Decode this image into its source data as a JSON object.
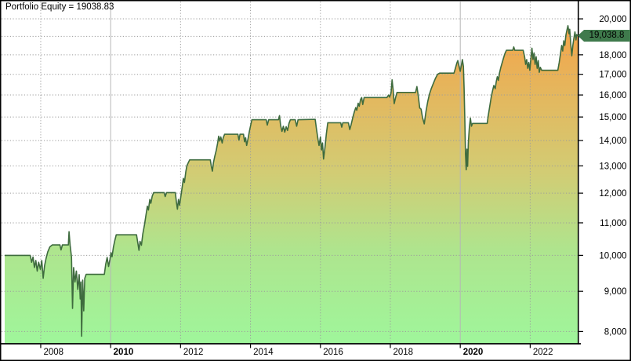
{
  "window": {
    "title": "Portfolio Equity = 19038.83"
  },
  "badge": {
    "label": "19,038.8"
  },
  "chart_data": {
    "type": "area",
    "title": "Portfolio Equity = 19038.83",
    "last_value": 19038.83,
    "legend": "none",
    "grid": true,
    "colors": {
      "line": "#3e6b3e",
      "fill_gradient": [
        "#f49f46",
        "#f0a94f",
        "#d2cc74",
        "#aee58e",
        "#9ff69b"
      ],
      "gradient_stops": [
        0,
        0.12,
        0.5,
        0.73,
        1
      ],
      "grid": "#9c9c9c",
      "decade_grid": "#b6b6b6",
      "axis": "#000000",
      "badge_bg": "#3f7a4c",
      "badge_text": "#000000",
      "background": "#ffffff"
    },
    "y_axis": {
      "side": "right",
      "scale": "log",
      "min": 7718,
      "max": 21040,
      "ticks": [
        {
          "value": 20000,
          "label": "20,000"
        },
        {
          "value": 19000,
          "label": ""
        },
        {
          "value": 18000,
          "label": "18,000"
        },
        {
          "value": 17000,
          "label": "17,000"
        },
        {
          "value": 16000,
          "label": "16,000"
        },
        {
          "value": 15000,
          "label": "15,000"
        },
        {
          "value": 14000,
          "label": "14,000"
        },
        {
          "value": 13000,
          "label": "13,000"
        },
        {
          "value": 12000,
          "label": "12,000"
        },
        {
          "value": 11000,
          "label": "11,000"
        },
        {
          "value": 10000,
          "label": "10,000"
        },
        {
          "value": 9000,
          "label": "9,000"
        },
        {
          "value": 8000,
          "label": "8,000"
        }
      ]
    },
    "x_axis": {
      "min": 2006.88,
      "max": 2023.37,
      "ticks": [
        {
          "year": 2008,
          "label": "2008",
          "bold": false
        },
        {
          "year": 2010,
          "label": "2010",
          "bold": true
        },
        {
          "year": 2012,
          "label": "2012",
          "bold": false
        },
        {
          "year": 2014,
          "label": "2014",
          "bold": false
        },
        {
          "year": 2016,
          "label": "2016",
          "bold": false
        },
        {
          "year": 2018,
          "label": "2018",
          "bold": false
        },
        {
          "year": 2020,
          "label": "2020",
          "bold": false
        },
        {
          "year": 2022,
          "label": "2022",
          "bold": false
        }
      ],
      "bold_ticks": [
        2010,
        2020
      ]
    },
    "series": [
      {
        "name": "Portfolio Equity",
        "points": [
          [
            2006.97,
            10000
          ],
          [
            2007.7,
            10000
          ],
          [
            2007.74,
            9800
          ],
          [
            2007.78,
            9950
          ],
          [
            2007.82,
            9650
          ],
          [
            2007.86,
            9850
          ],
          [
            2007.9,
            9550
          ],
          [
            2007.94,
            9800
          ],
          [
            2007.99,
            9600
          ],
          [
            2008.03,
            9850
          ],
          [
            2008.07,
            9350
          ],
          [
            2008.11,
            9700
          ],
          [
            2008.15,
            9900
          ],
          [
            2008.2,
            10100
          ],
          [
            2008.26,
            10250
          ],
          [
            2008.33,
            10310
          ],
          [
            2008.55,
            10310
          ],
          [
            2008.58,
            10160
          ],
          [
            2008.62,
            10310
          ],
          [
            2008.79,
            10310
          ],
          [
            2008.81,
            10720
          ],
          [
            2008.84,
            10310
          ],
          [
            2008.88,
            9950
          ],
          [
            2008.91,
            8560
          ],
          [
            2008.94,
            9650
          ],
          [
            2008.98,
            9250
          ],
          [
            2009.02,
            9550
          ],
          [
            2009.06,
            9050
          ],
          [
            2009.1,
            9450
          ],
          [
            2009.13,
            8800
          ],
          [
            2009.15,
            9250
          ],
          [
            2009.17,
            7890
          ],
          [
            2009.2,
            9300
          ],
          [
            2009.23,
            8500
          ],
          [
            2009.26,
            9350
          ],
          [
            2009.3,
            9460
          ],
          [
            2009.82,
            9460
          ],
          [
            2009.86,
            9750
          ],
          [
            2009.9,
            9940
          ],
          [
            2009.94,
            9680
          ],
          [
            2009.98,
            9880
          ],
          [
            2010.01,
            10080
          ],
          [
            2010.04,
            9960
          ],
          [
            2010.08,
            10250
          ],
          [
            2010.12,
            10450
          ],
          [
            2010.16,
            10620
          ],
          [
            2010.74,
            10620
          ],
          [
            2010.78,
            10350
          ],
          [
            2010.81,
            10150
          ],
          [
            2010.84,
            10420
          ],
          [
            2010.88,
            10300
          ],
          [
            2010.92,
            10650
          ],
          [
            2010.97,
            10950
          ],
          [
            2011.01,
            11250
          ],
          [
            2011.05,
            11550
          ],
          [
            2011.08,
            11420
          ],
          [
            2011.12,
            11780
          ],
          [
            2011.15,
            11650
          ],
          [
            2011.19,
            11900
          ],
          [
            2011.23,
            12020
          ],
          [
            2011.53,
            12020
          ],
          [
            2011.56,
            11880
          ],
          [
            2011.6,
            12020
          ],
          [
            2011.85,
            12020
          ],
          [
            2011.88,
            11700
          ],
          [
            2011.91,
            11450
          ],
          [
            2011.94,
            11780
          ],
          [
            2011.97,
            11580
          ],
          [
            2012.01,
            11900
          ],
          [
            2012.05,
            12250
          ],
          [
            2012.08,
            12530
          ],
          [
            2012.11,
            12380
          ],
          [
            2012.15,
            12780
          ],
          [
            2012.18,
            13000
          ],
          [
            2012.22,
            13120
          ],
          [
            2012.26,
            13230
          ],
          [
            2012.85,
            13230
          ],
          [
            2012.88,
            12980
          ],
          [
            2012.91,
            12800
          ],
          [
            2012.94,
            13120
          ],
          [
            2012.98,
            13380
          ],
          [
            2013.02,
            13600
          ],
          [
            2013.06,
            13900
          ],
          [
            2013.09,
            14180
          ],
          [
            2013.12,
            13980
          ],
          [
            2013.15,
            14150
          ],
          [
            2013.19,
            13900
          ],
          [
            2013.22,
            14120
          ],
          [
            2013.26,
            14260
          ],
          [
            2013.64,
            14260
          ],
          [
            2013.67,
            14020
          ],
          [
            2013.7,
            14260
          ],
          [
            2013.8,
            14260
          ],
          [
            2013.83,
            13950
          ],
          [
            2013.86,
            14120
          ],
          [
            2013.89,
            13800
          ],
          [
            2013.93,
            14080
          ],
          [
            2013.97,
            14400
          ],
          [
            2014.01,
            14680
          ],
          [
            2014.04,
            14880
          ],
          [
            2014.45,
            14880
          ],
          [
            2014.48,
            14650
          ],
          [
            2014.52,
            14880
          ],
          [
            2014.8,
            14880
          ],
          [
            2014.83,
            15060
          ],
          [
            2014.86,
            14650
          ],
          [
            2014.9,
            14380
          ],
          [
            2014.94,
            14600
          ],
          [
            2014.98,
            14350
          ],
          [
            2015.02,
            14580
          ],
          [
            2015.06,
            14420
          ],
          [
            2015.1,
            14720
          ],
          [
            2015.14,
            14880
          ],
          [
            2015.28,
            14880
          ],
          [
            2015.32,
            14600
          ],
          [
            2015.36,
            14880
          ],
          [
            2015.85,
            14900
          ],
          [
            2015.89,
            14450
          ],
          [
            2015.93,
            14050
          ],
          [
            2015.96,
            13800
          ],
          [
            2016.0,
            14150
          ],
          [
            2016.03,
            13620
          ],
          [
            2016.06,
            13900
          ],
          [
            2016.09,
            13260
          ],
          [
            2016.13,
            13720
          ],
          [
            2016.17,
            14280
          ],
          [
            2016.21,
            14750
          ],
          [
            2016.58,
            14750
          ],
          [
            2016.61,
            14560
          ],
          [
            2016.64,
            14750
          ],
          [
            2016.8,
            14750
          ],
          [
            2016.84,
            14460
          ],
          [
            2016.88,
            14680
          ],
          [
            2016.93,
            15000
          ],
          [
            2016.97,
            15230
          ],
          [
            2017.01,
            15420
          ],
          [
            2017.04,
            15300
          ],
          [
            2017.08,
            15620
          ],
          [
            2017.11,
            15480
          ],
          [
            2017.15,
            15800
          ],
          [
            2017.18,
            15880
          ],
          [
            2017.21,
            15560
          ],
          [
            2017.25,
            15880
          ],
          [
            2017.9,
            15880
          ],
          [
            2017.95,
            16000
          ],
          [
            2017.98,
            15900
          ],
          [
            2018.02,
            16100
          ],
          [
            2018.05,
            16730
          ],
          [
            2018.08,
            16250
          ],
          [
            2018.11,
            15600
          ],
          [
            2018.15,
            15880
          ],
          [
            2018.19,
            16120
          ],
          [
            2018.72,
            16120
          ],
          [
            2018.76,
            16400
          ],
          [
            2018.8,
            15950
          ],
          [
            2018.84,
            15400
          ],
          [
            2018.88,
            15350
          ],
          [
            2018.92,
            14980
          ],
          [
            2018.97,
            14700
          ],
          [
            2019.02,
            15250
          ],
          [
            2019.07,
            15700
          ],
          [
            2019.12,
            16050
          ],
          [
            2019.17,
            16300
          ],
          [
            2019.23,
            16550
          ],
          [
            2019.29,
            16800
          ],
          [
            2019.35,
            17000
          ],
          [
            2019.41,
            17060
          ],
          [
            2019.82,
            17060
          ],
          [
            2019.86,
            17300
          ],
          [
            2019.9,
            17560
          ],
          [
            2019.93,
            17700
          ],
          [
            2019.96,
            17440
          ],
          [
            2020.0,
            17150
          ],
          [
            2020.03,
            17440
          ],
          [
            2020.06,
            17750
          ],
          [
            2020.09,
            17400
          ],
          [
            2020.11,
            16300
          ],
          [
            2020.13,
            14900
          ],
          [
            2020.15,
            13450
          ],
          [
            2020.17,
            12850
          ],
          [
            2020.19,
            13650
          ],
          [
            2020.21,
            12980
          ],
          [
            2020.23,
            13900
          ],
          [
            2020.26,
            14550
          ],
          [
            2020.29,
            14950
          ],
          [
            2020.32,
            14600
          ],
          [
            2020.35,
            14720
          ],
          [
            2020.77,
            14720
          ],
          [
            2020.8,
            15060
          ],
          [
            2020.85,
            15550
          ],
          [
            2020.89,
            15950
          ],
          [
            2020.93,
            16250
          ],
          [
            2020.96,
            16450
          ],
          [
            2021.0,
            16300
          ],
          [
            2021.03,
            16650
          ],
          [
            2021.06,
            16880
          ],
          [
            2021.09,
            16700
          ],
          [
            2021.12,
            17050
          ],
          [
            2021.16,
            17350
          ],
          [
            2021.2,
            17600
          ],
          [
            2021.24,
            17850
          ],
          [
            2021.28,
            18080
          ],
          [
            2021.32,
            18240
          ],
          [
            2021.5,
            18240
          ],
          [
            2021.53,
            18420
          ],
          [
            2021.56,
            18240
          ],
          [
            2021.8,
            18240
          ],
          [
            2021.84,
            17900
          ],
          [
            2021.87,
            17500
          ],
          [
            2021.9,
            17750
          ],
          [
            2021.93,
            17300
          ],
          [
            2021.96,
            17600
          ],
          [
            2021.99,
            17200
          ],
          [
            2022.02,
            17800
          ],
          [
            2022.05,
            18350
          ],
          [
            2022.08,
            17750
          ],
          [
            2022.11,
            18100
          ],
          [
            2022.14,
            17500
          ],
          [
            2022.17,
            17900
          ],
          [
            2022.2,
            17300
          ],
          [
            2022.23,
            17700
          ],
          [
            2022.26,
            17100
          ],
          [
            2022.29,
            17350
          ],
          [
            2022.33,
            17200
          ],
          [
            2022.79,
            17200
          ],
          [
            2022.83,
            17600
          ],
          [
            2022.87,
            18100
          ],
          [
            2022.9,
            18500
          ],
          [
            2022.93,
            18200
          ],
          [
            2022.96,
            18750
          ],
          [
            2022.99,
            18500
          ],
          [
            2023.02,
            19050
          ],
          [
            2023.05,
            19350
          ],
          [
            2023.08,
            19600
          ],
          [
            2023.11,
            19150
          ],
          [
            2023.13,
            19400
          ],
          [
            2023.16,
            18600
          ],
          [
            2023.19,
            17950
          ],
          [
            2023.22,
            18500
          ],
          [
            2023.25,
            18900
          ],
          [
            2023.28,
            19250
          ],
          [
            2023.31,
            18800
          ],
          [
            2023.33,
            19100
          ],
          [
            2023.36,
            19038.83
          ]
        ]
      }
    ]
  }
}
